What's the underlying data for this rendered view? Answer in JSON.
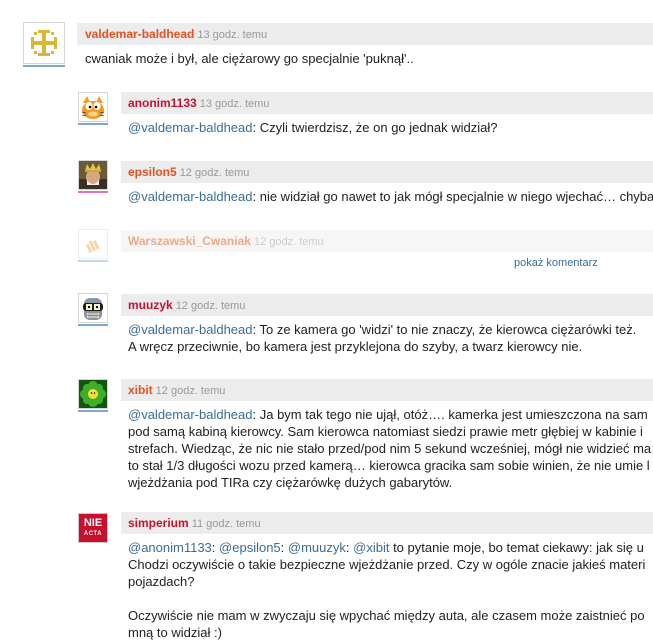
{
  "comments": [
    {
      "author": "valdemar-baldhead",
      "time": "13 godz. temu",
      "lines": [
        "cwaniak może i był, ale ciężarowy go specjalnie 'puknął'.."
      ]
    },
    {
      "author": "anonim1133",
      "time": "13 godz. temu",
      "mention": "@valdemar-baldhead",
      "lines": [
        ": Czyli twierdzisz, że on go jednak widział?"
      ]
    },
    {
      "author": "epsilon5",
      "time": "12 godz. temu",
      "mention": "@valdemar-baldhead",
      "lines": [
        ": nie widział go nawet to jak mógł specjalnie w niego wjechać… chyba"
      ]
    },
    {
      "author": "Warszawski_Cwaniak",
      "time": "12 godz. temu",
      "show_comment": "pokaż komentarz"
    },
    {
      "author": "muuzyk",
      "time": "12 godz. temu",
      "mention": "@valdemar-baldhead",
      "lines": [
        ": To ze kamera go 'widzi' to nie znaczy, że kierowca ciężarówki też.",
        "A wręcz przeciwnie, bo kamera jest przyklejona do szyby, a twarz kierowcy nie."
      ]
    },
    {
      "author": "xibit",
      "time": "12 godz. temu",
      "mention": "@valdemar-baldhead",
      "lines": [
        ": Ja bym tak tego nie ujął, otóż…. kamerka jest umieszczona na sam",
        "pod samą kabiną kierowcy. Sam kierowca natomiast siedzi prawie metr głębiej w kabinie i",
        "strefach. Wiedząc, że nic nie stało przed/pod nim 5 sekund wcześniej, mógł nie widzieć ma",
        "to stał 1/3 długości wozu przed kamerą… kierowca gracika sam sobie winien, że nie umie l",
        "wjeżdżania pod TIRa czy ciężarówkę dużych gabarytów."
      ]
    },
    {
      "author": "simperium",
      "time": "11 godz. temu",
      "mentions": [
        "@anonim1133",
        "@epsilon5",
        "@muuzyk",
        "@xibit"
      ],
      "sep": ": ",
      "first_line_tail": " to pytanie moje, bo temat ciekawy: jak się u",
      "lines": [
        "Chodzi oczywiście o takie bezpieczne wjeżdżanie przed. Czy w ogóle znacie jakieś materi",
        "pojazdach?",
        "",
        "Oczywiście nie mam w zwyczaju się wpychać między auta, ale czasem może zaistnieć po",
        "mną to widział :)"
      ],
      "avatar_text": [
        "NIE",
        "ACTA"
      ]
    }
  ],
  "colors": {
    "author_orange": "#e8501f",
    "author_red": "#c4122e",
    "author_faded": "#f0a987",
    "mention": "#3a6d9a",
    "header_bg": "#ececec",
    "avatar_line_blue": "#7ea7d8",
    "avatar_line_pink": "#e070c8"
  }
}
